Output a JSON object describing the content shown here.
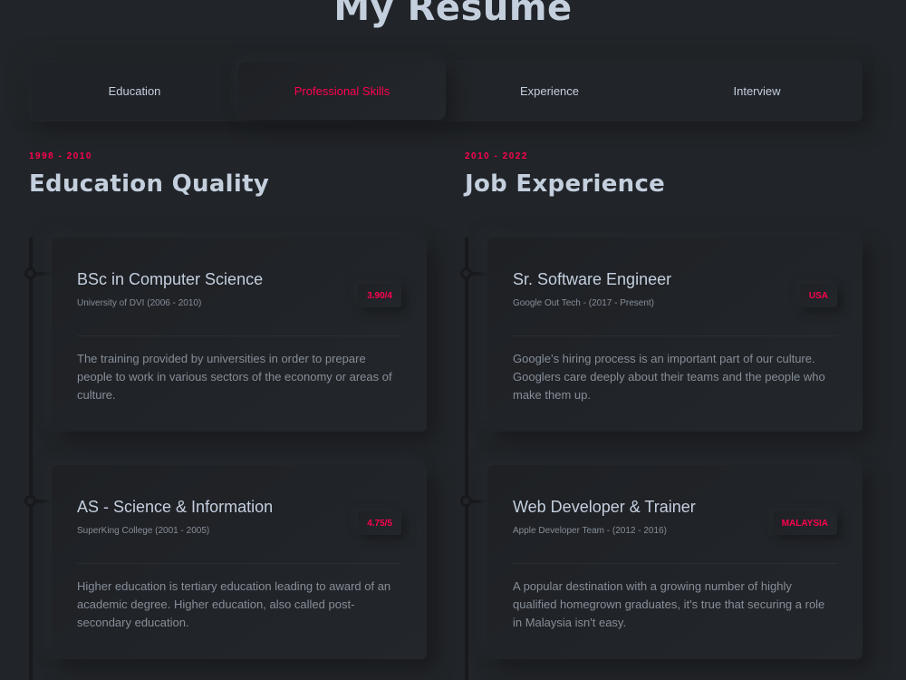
{
  "page": {
    "title": "My Resume"
  },
  "tabs": [
    {
      "label": "Education",
      "active": false
    },
    {
      "label": "Professional Skills",
      "active": true
    },
    {
      "label": "Experience",
      "active": false
    },
    {
      "label": "Interview",
      "active": false
    }
  ],
  "colors": {
    "accent": "#ff014f",
    "background": "#212428",
    "text": "#c4cfde",
    "muted": "#878e99"
  },
  "education": {
    "years": "1998 - 2010",
    "heading": "Education Quality",
    "items": [
      {
        "title": "BSc in Computer Science",
        "subtitle": "University of DVI (2006 - 2010)",
        "badge": "3.90/4",
        "text": "The training provided by universities in order to prepare people to work in various sectors of the economy or areas of culture."
      },
      {
        "title": "AS - Science & Information",
        "subtitle": "SuperKing College (2001 - 2005)",
        "badge": "4.75/5",
        "text": "Higher education is tertiary education leading to award of an academic degree. Higher education, also called post-secondary education."
      }
    ]
  },
  "experience": {
    "years": "2010 - 2022",
    "heading": "Job Experience",
    "items": [
      {
        "title": "Sr. Software Engineer",
        "subtitle": "Google Out Tech - (2017 - Present)",
        "badge": "USA",
        "text": "Google’s hiring process is an important part of our culture. Googlers care deeply about their teams and the people who make them up."
      },
      {
        "title": "Web Developer & Trainer",
        "subtitle": "Apple Developer Team - (2012 - 2016)",
        "badge": "MALAYSIA",
        "text": "A popular destination with a growing number of highly qualified homegrown graduates, it's true that securing a role in Malaysia isn't easy."
      }
    ]
  }
}
